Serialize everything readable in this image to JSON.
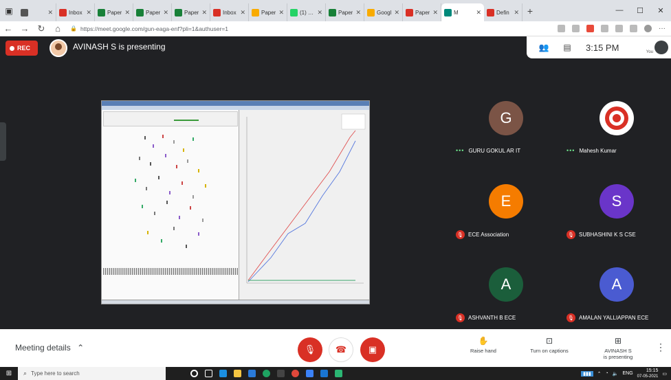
{
  "browser": {
    "tabs": [
      {
        "label": "",
        "color": "#555555"
      },
      {
        "label": "Inbox",
        "color": "#d93025"
      },
      {
        "label": "Paper",
        "color": "#188038"
      },
      {
        "label": "Paper",
        "color": "#188038"
      },
      {
        "label": "Paper",
        "color": "#188038"
      },
      {
        "label": "Inbox",
        "color": "#d93025"
      },
      {
        "label": "Paper",
        "color": "#f9ab00"
      },
      {
        "label": "(1) Wh",
        "color": "#25d366"
      },
      {
        "label": "Paper",
        "color": "#188038"
      },
      {
        "label": "Googl",
        "color": "#f9ab00"
      },
      {
        "label": "Paper",
        "color": "#d93025"
      },
      {
        "label": "M",
        "color": "#00897b",
        "active": true
      },
      {
        "label": "Defin",
        "color": "#d93025"
      }
    ],
    "url": "https://meet.google.com/gun-eaga-enf?pli=1&authuser=1"
  },
  "meet": {
    "rec_label": "REC",
    "presenting_text": "AVINASH S is presenting",
    "time": "3:15 PM",
    "you_label": "You",
    "participants": [
      {
        "name": "GURU GOKUL AR IT",
        "initial": "G",
        "color": "#7b5446",
        "status": "speaking"
      },
      {
        "name": "Mahesh Kumar",
        "initial": "",
        "color": "#ffffff",
        "status": "speaking",
        "icon": "target-icon"
      },
      {
        "name": "ECE Association",
        "initial": "E",
        "color": "#f57c00",
        "status": "muted"
      },
      {
        "name": "SUBHASHINI K S CSE",
        "initial": "S",
        "color": "#6a35c9",
        "status": "muted"
      },
      {
        "name": "ASHVANTH B ECE",
        "initial": "A",
        "color": "#1b5e3b",
        "status": "muted"
      },
      {
        "name": "AMALAN YALLIAPPAN ECE",
        "initial": "A",
        "color": "#4a5bd1",
        "status": "muted"
      }
    ]
  },
  "controls": {
    "meeting_details": "Meeting details",
    "raise_hand": "Raise hand",
    "captions": "Turn on captions",
    "presenting_line1": "AVINASH S",
    "presenting_line2": "is presenting"
  },
  "taskbar": {
    "search_placeholder": "Type here to search",
    "time": "15:15",
    "date": "07-05-2021",
    "lang": "ENG"
  }
}
